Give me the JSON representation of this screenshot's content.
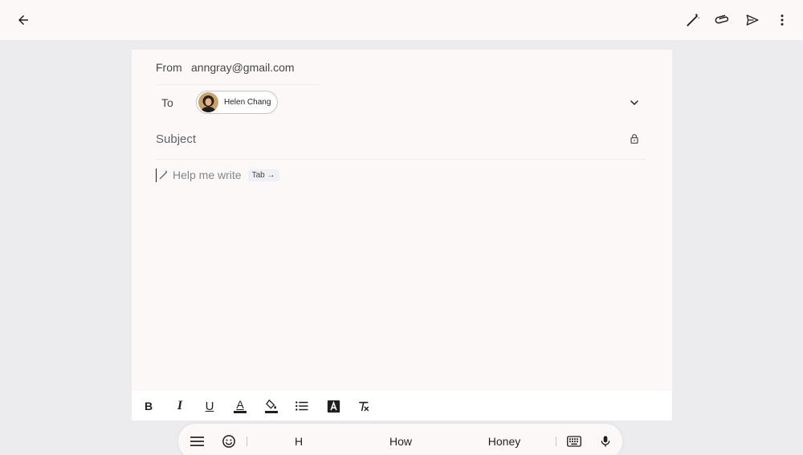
{
  "topbar": {
    "back_icon": "arrow-back-icon",
    "actions": [
      "magic-pen-icon",
      "attach-icon",
      "send-icon",
      "more-vert-icon"
    ]
  },
  "compose": {
    "from_label": "From",
    "from_value": "anngray@gmail.com",
    "to_label": "To",
    "recipient_name": "Helen Chang",
    "subject_placeholder": "Subject",
    "help_me_write": "Help me write",
    "tab_hint": "Tab →"
  },
  "format_toolbar": {
    "bold": "B",
    "italic": "I",
    "underline": "U",
    "text_color": "A"
  },
  "keyboard": {
    "suggestions": [
      "H",
      "How",
      "Honey"
    ]
  },
  "colors": {
    "background": "#ececef",
    "surface": "#fdf8f8",
    "icon": "#1f1f1f"
  }
}
